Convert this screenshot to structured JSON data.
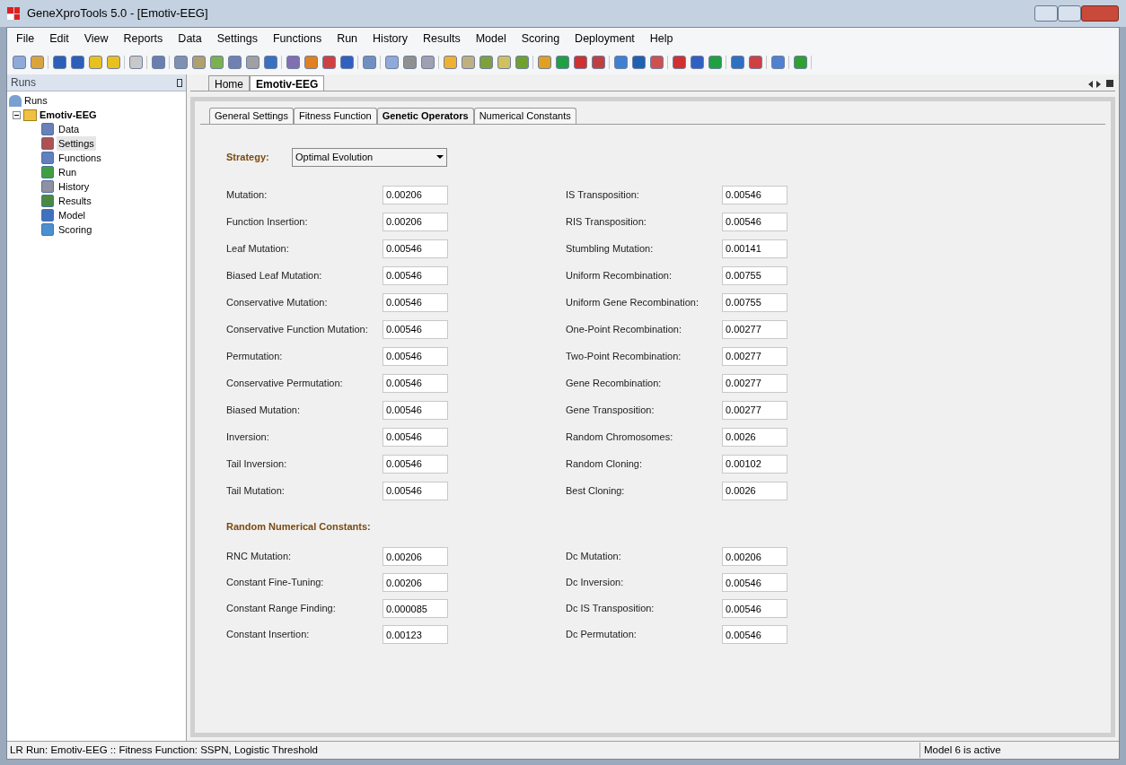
{
  "window": {
    "title": "GeneXproTools 5.0 - [Emotiv-EEG]"
  },
  "menu": [
    "File",
    "Edit",
    "View",
    "Reports",
    "Data",
    "Settings",
    "Functions",
    "Run",
    "History",
    "Results",
    "Model",
    "Scoring",
    "Deployment",
    "Help"
  ],
  "sidebar": {
    "title": "Runs",
    "root": "Runs",
    "project": {
      "label": "Emotiv-EEG",
      "expanded": true,
      "children": [
        {
          "label": "Data",
          "selected": false
        },
        {
          "label": "Settings",
          "selected": true
        },
        {
          "label": "Functions",
          "selected": false
        },
        {
          "label": "Run",
          "selected": false
        },
        {
          "label": "History",
          "selected": false
        },
        {
          "label": "Results",
          "selected": false
        },
        {
          "label": "Model",
          "selected": false
        },
        {
          "label": "Scoring",
          "selected": false
        }
      ]
    }
  },
  "doc_tabs": [
    {
      "label": "Home",
      "selected": false
    },
    {
      "label": "Emotiv-EEG",
      "selected": true
    }
  ],
  "tabs": [
    {
      "label": "General Settings",
      "selected": false
    },
    {
      "label": "Fitness Function",
      "selected": false
    },
    {
      "label": "Genetic Operators",
      "selected": true
    },
    {
      "label": "Numerical Constants",
      "selected": false
    }
  ],
  "strategy": {
    "label": "Strategy:",
    "value": "Optimal Evolution"
  },
  "operators_left": [
    {
      "label": "Mutation:",
      "value": "0.00206"
    },
    {
      "label": "Function Insertion:",
      "value": "0.00206"
    },
    {
      "label": "Leaf Mutation:",
      "value": "0.00546"
    },
    {
      "label": "Biased Leaf Mutation:",
      "value": "0.00546"
    },
    {
      "label": "Conservative Mutation:",
      "value": "0.00546"
    },
    {
      "label": "Conservative Function Mutation:",
      "value": "0.00546"
    },
    {
      "label": "Permutation:",
      "value": "0.00546"
    },
    {
      "label": "Conservative Permutation:",
      "value": "0.00546"
    },
    {
      "label": "Biased Mutation:",
      "value": "0.00546"
    },
    {
      "label": "Inversion:",
      "value": "0.00546"
    },
    {
      "label": "Tail Inversion:",
      "value": "0.00546"
    },
    {
      "label": "Tail Mutation:",
      "value": "0.00546"
    }
  ],
  "operators_right": [
    {
      "label": "IS Transposition:",
      "value": "0.00546"
    },
    {
      "label": "RIS Transposition:",
      "value": "0.00546"
    },
    {
      "label": "Stumbling Mutation:",
      "value": "0.00141"
    },
    {
      "label": "Uniform Recombination:",
      "value": "0.00755"
    },
    {
      "label": "Uniform Gene Recombination:",
      "value": "0.00755"
    },
    {
      "label": "One-Point Recombination:",
      "value": "0.00277"
    },
    {
      "label": "Two-Point Recombination:",
      "value": "0.00277"
    },
    {
      "label": "Gene Recombination:",
      "value": "0.00277"
    },
    {
      "label": "Gene Transposition:",
      "value": "0.00277"
    },
    {
      "label": "Random Chromosomes:",
      "value": "0.0026"
    },
    {
      "label": "Random Cloning:",
      "value": "0.00102"
    },
    {
      "label": "Best Cloning:",
      "value": "0.0026"
    }
  ],
  "rnc_title": "Random Numerical Constants:",
  "rnc_left": [
    {
      "label": "RNC Mutation:",
      "value": "0.00206"
    },
    {
      "label": "Constant Fine-Tuning:",
      "value": "0.00206"
    },
    {
      "label": "Constant Range Finding:",
      "value": "0.000085"
    },
    {
      "label": "Constant Insertion:",
      "value": "0.00123"
    }
  ],
  "rnc_right": [
    {
      "label": "Dc Mutation:",
      "value": "0.00206"
    },
    {
      "label": "Dc Inversion:",
      "value": "0.00546"
    },
    {
      "label": "Dc IS Transposition:",
      "value": "0.00546"
    },
    {
      "label": "Dc Permutation:",
      "value": "0.00546"
    }
  ],
  "status_bar": {
    "left": "LR Run: Emotiv-EEG :: Fitness Function: SSPN, Logistic Threshold",
    "right": "Model 6 is active"
  }
}
